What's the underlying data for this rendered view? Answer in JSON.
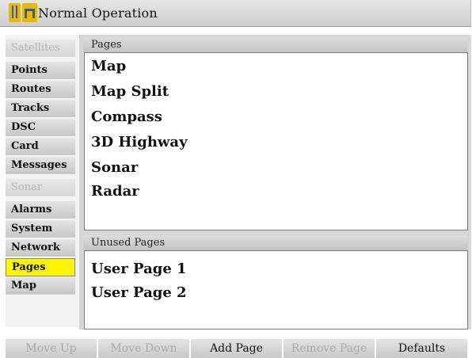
{
  "window": {
    "title": "Normal Operation"
  },
  "sidebar": {
    "items": [
      {
        "label": "Satellites",
        "disabled": true
      },
      {
        "label": "Points"
      },
      {
        "label": "Routes"
      },
      {
        "label": "Tracks"
      },
      {
        "label": "DSC"
      },
      {
        "label": "Card"
      },
      {
        "label": "Messages"
      },
      {
        "label": "Sonar",
        "disabled": true
      },
      {
        "label": "Alarms"
      },
      {
        "label": "System"
      },
      {
        "label": "Network"
      },
      {
        "label": "Pages",
        "selected": true
      },
      {
        "label": "Map"
      }
    ]
  },
  "pages_panel": {
    "header": "Pages",
    "items": [
      "Map",
      "Map Split",
      "Compass",
      "3D Highway",
      "Sonar",
      "Radar"
    ]
  },
  "unused_panel": {
    "header": "Unused Pages",
    "items": [
      "User Page 1",
      "User Page 2"
    ]
  },
  "softkeys": [
    {
      "label": "Move Up",
      "disabled": true
    },
    {
      "label": "Move Down",
      "disabled": true
    },
    {
      "label": "Add Page"
    },
    {
      "label": "Remove Page",
      "disabled": true
    },
    {
      "label": "Defaults"
    }
  ],
  "colors": {
    "selected": "#fff600",
    "disabled_text": "#b4b4b4"
  }
}
